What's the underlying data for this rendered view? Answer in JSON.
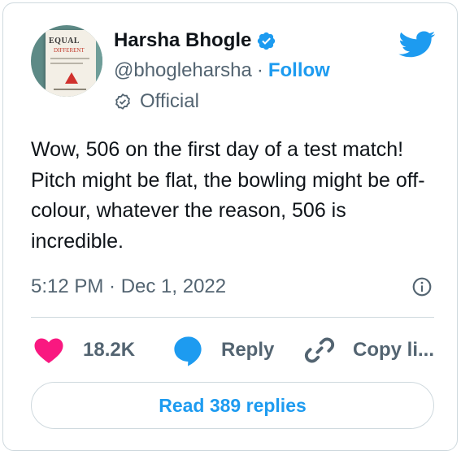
{
  "author": {
    "name": "Harsha Bhogle",
    "handle": "@bhogleharsha",
    "follow_label": "Follow",
    "label_badge": "Official",
    "avatar_book_title": "EQUAL",
    "avatar_book_subtitle": "DIFFERENT"
  },
  "tweet": {
    "text": "Wow, 506 on the first day of a test match! Pitch might be flat, the bowling might be off-colour, whatever the reason, 506 is incredible.",
    "timestamp": "5:12 PM · Dec 1, 2022"
  },
  "actions": {
    "likes": "18.2K",
    "reply_label": "Reply",
    "copy_label": "Copy li..."
  },
  "replies_button": "Read 389 replies",
  "icons": {
    "brand": "twitter-bird-icon",
    "verified": "verified-badge-icon",
    "official": "official-badge-icon",
    "info": "info-icon",
    "like": "heart-icon",
    "reply": "speech-bubble-icon",
    "copy": "link-icon"
  },
  "colors": {
    "accent": "#1d9bf0",
    "like": "#f91880",
    "text": "#0f1419",
    "muted": "#536471",
    "border": "#cfd9de"
  }
}
